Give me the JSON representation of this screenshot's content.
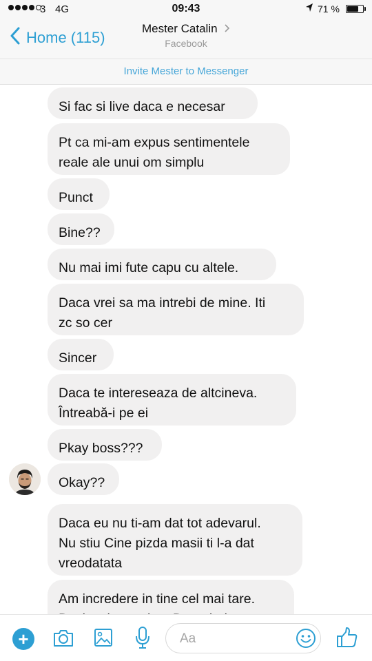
{
  "status_bar": {
    "carrier": "3",
    "network": "4G",
    "time": "09:43",
    "battery_percent": "71 %",
    "battery_level": 0.71
  },
  "header": {
    "back_label": "Home (115)",
    "contact_name": "Mester Catalin",
    "subtitle": "Facebook"
  },
  "invite": {
    "label": "Invite Mester to Messenger"
  },
  "messages": [
    {
      "text": "Si fac si live daca e necesar"
    },
    {
      "text": "Pt ca mi-am expus sentimentele\nreale ale unui om simplu"
    },
    {
      "text": "Punct"
    },
    {
      "text": "Bine??"
    },
    {
      "text": "Nu mai imi fute capu cu altele."
    },
    {
      "text": "Daca vrei sa ma intrebi de mine. Iti\nzc so cer"
    },
    {
      "text": "Sincer"
    },
    {
      "text": "Daca te intereseaza de altcineva.\nÎntreabă-i pe ei"
    },
    {
      "text": "Pkay boss???"
    },
    {
      "text": "Okay??"
    },
    {
      "text": "Daca eu nu ti-am dat tot adevarul.\nNu stiu Cine pizda masii ti l-a dat\nvreodatata"
    },
    {
      "text": "Am incredere in tine cel mai tare.\nDesi esti o straina. Dar mi-ai"
    }
  ],
  "composer": {
    "placeholder": "Aa",
    "colors": {
      "accent": "#2d9fd3",
      "bubble": "#f1f0f0"
    }
  },
  "icons": [
    "back-chevron-icon",
    "chevron-right-icon",
    "location-arrow-icon",
    "battery-icon",
    "plus-icon",
    "camera-icon",
    "image-icon",
    "microphone-icon",
    "emoji-icon",
    "thumbs-up-icon"
  ]
}
